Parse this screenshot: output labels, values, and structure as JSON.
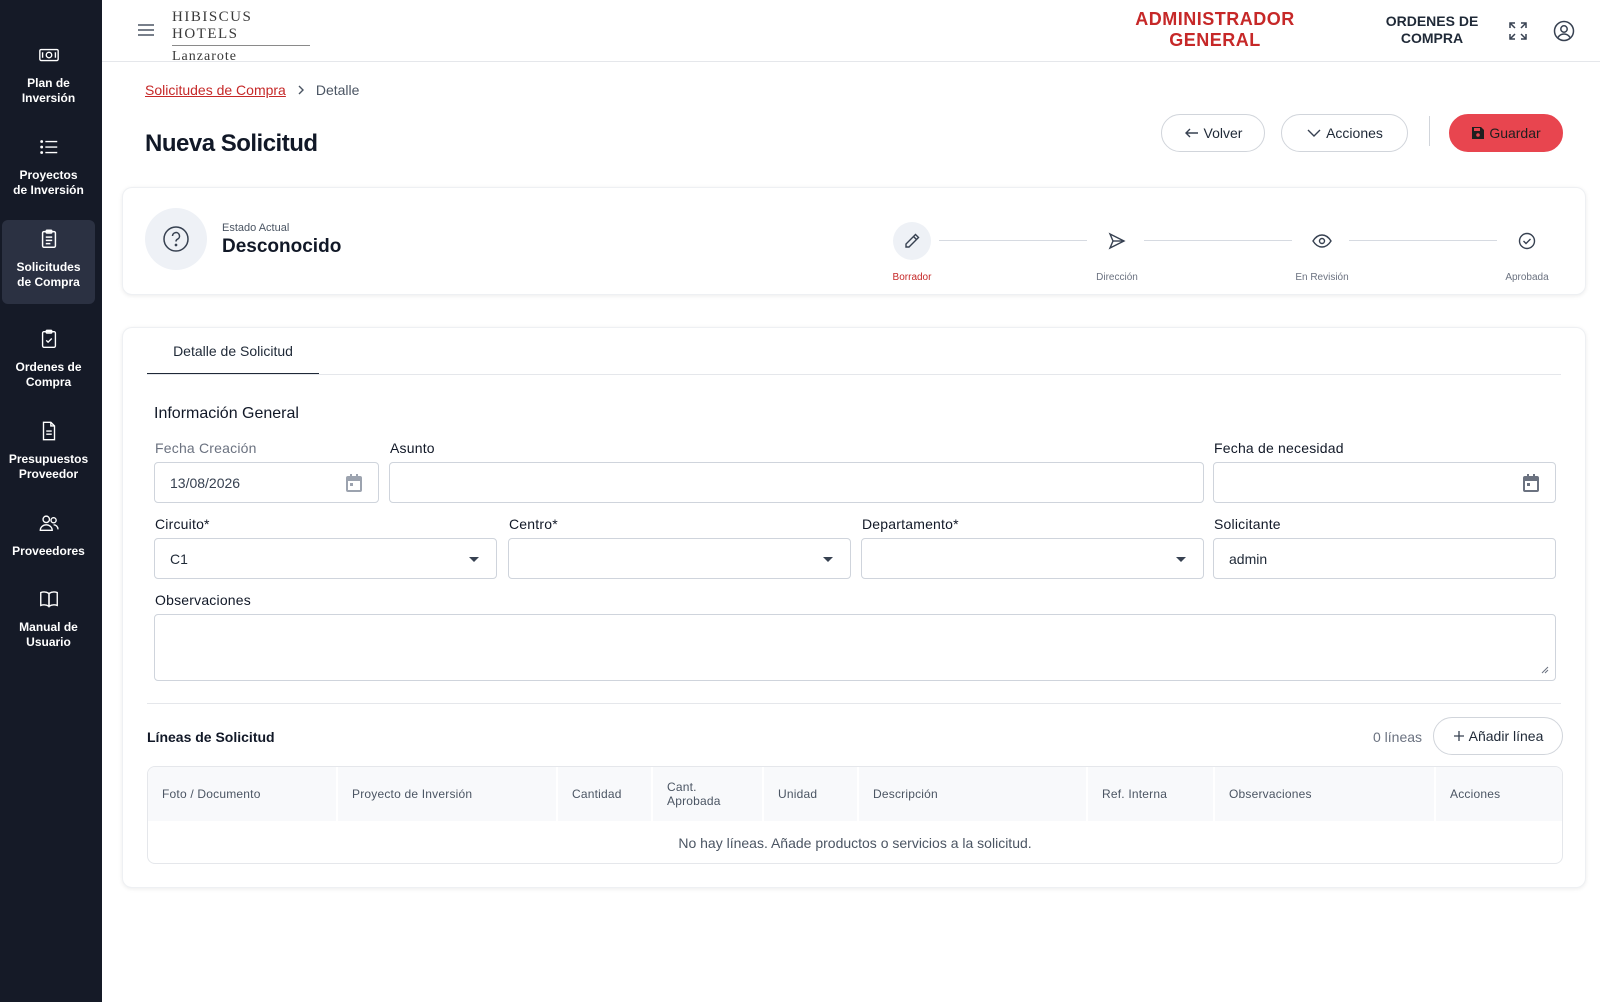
{
  "sidebar": {
    "items": [
      {
        "label": "Plan de\nInversión",
        "icon": "money-icon",
        "active": false
      },
      {
        "label": "Proyectos\nde Inversión",
        "icon": "list-icon",
        "active": false
      },
      {
        "label": "Solicitudes\nde Compra",
        "icon": "clipboard-icon",
        "active": true
      },
      {
        "label": "Ordenes de\nCompra",
        "icon": "clipboard-check-icon",
        "active": false
      },
      {
        "label": "Presupuestos\nProveedor",
        "icon": "document-icon",
        "active": false
      },
      {
        "label": "Proveedores",
        "icon": "users-icon",
        "active": false
      },
      {
        "label": "Manual de\nUsuario",
        "icon": "book-icon",
        "active": false
      }
    ]
  },
  "header": {
    "logo_top": "HIBISCUS HOTELS",
    "logo_bottom": "Lanzarote",
    "role": "ADMINISTRADOR\nGENERAL",
    "module": "ORDENES DE\nCOMPRA"
  },
  "breadcrumb": {
    "parent": "Solicitudes de Compra",
    "separator": ">",
    "current": "Detalle"
  },
  "page": {
    "title": "Nueva Solicitud",
    "back_label": "Volver",
    "actions_label": "Acciones",
    "save_label": "Guardar"
  },
  "status": {
    "caption": "Estado Actual",
    "value": "Desconocido",
    "steps": [
      {
        "label": "Borrador",
        "icon": "pencil-icon",
        "active": true
      },
      {
        "label": "Dirección",
        "icon": "send-icon",
        "active": false
      },
      {
        "label": "En Revisión",
        "icon": "eye-icon",
        "active": false
      },
      {
        "label": "Aprobada",
        "icon": "check-circle-icon",
        "active": false
      }
    ]
  },
  "form": {
    "tab_label": "Detalle de Solicitud",
    "section_title": "Información General",
    "fecha_creacion_label": "Fecha Creación",
    "fecha_creacion_value": "13/08/2026",
    "asunto_label": "Asunto",
    "asunto_value": "",
    "fecha_necesidad_label": "Fecha de necesidad",
    "fecha_necesidad_value": "",
    "circuito_label": "Circuito*",
    "circuito_value": "C1",
    "centro_label": "Centro*",
    "centro_value": "",
    "departamento_label": "Departamento*",
    "departamento_value": "",
    "solicitante_label": "Solicitante",
    "solicitante_value": "admin",
    "observaciones_label": "Observaciones",
    "observaciones_value": ""
  },
  "lines": {
    "title": "Líneas de Solicitud",
    "count_label": "0 líneas",
    "add_label": "Añadir línea",
    "columns": [
      "Foto / Documento",
      "Proyecto de Inversión",
      "Cantidad",
      "Cant.\nAprobada",
      "Unidad",
      "Descripción",
      "Ref. Interna",
      "Observaciones",
      "Acciones"
    ],
    "empty_message": "No hay líneas. Añade productos o servicios a la solicitud."
  },
  "colors": {
    "accent": "#c62828",
    "primary_button": "#e8454f",
    "sidebar_bg": "#151a27"
  }
}
